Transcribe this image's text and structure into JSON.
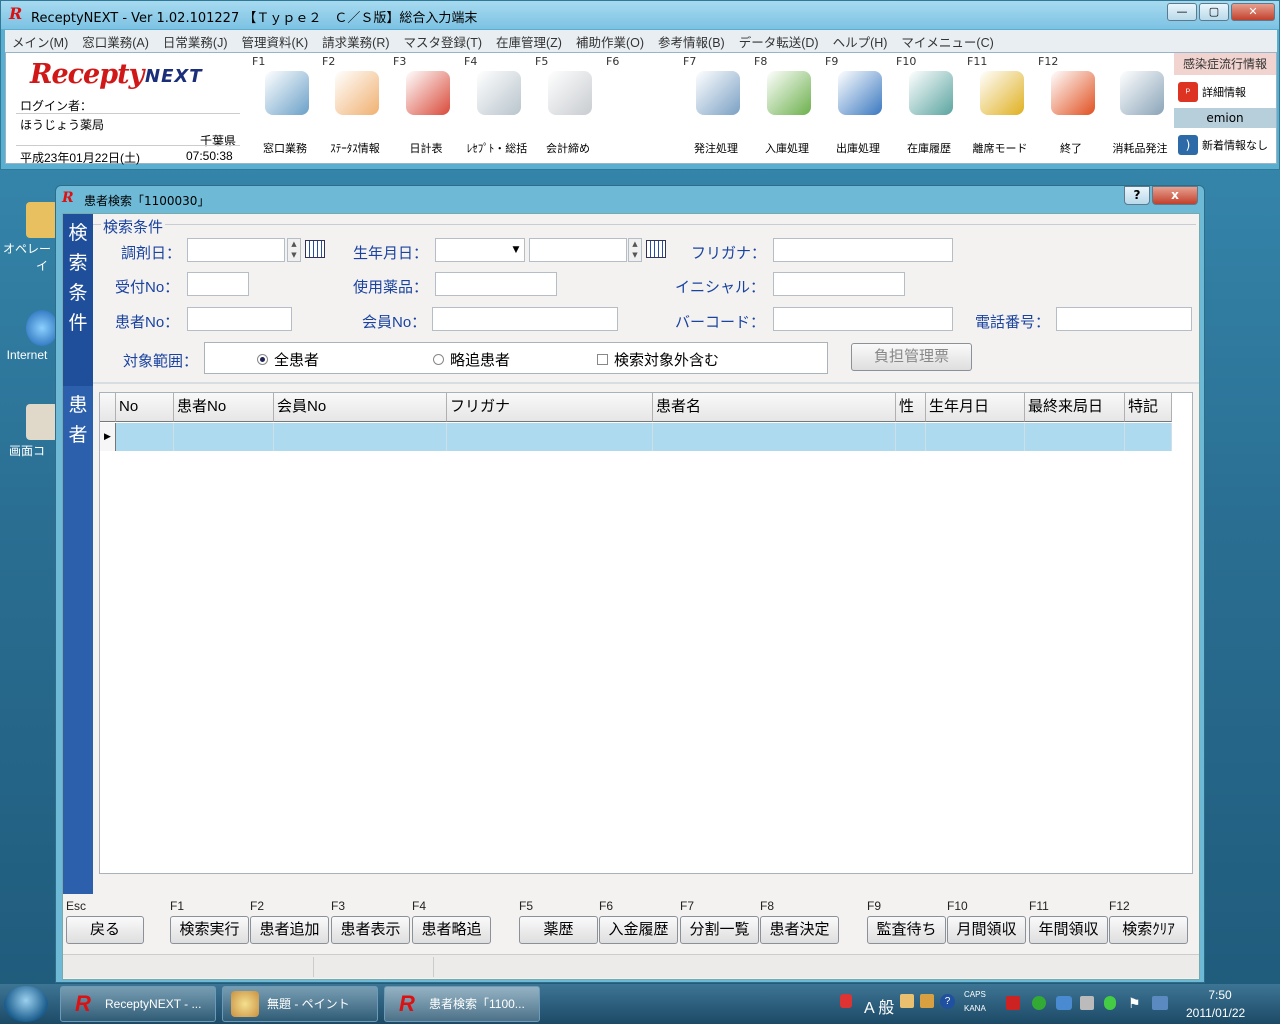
{
  "main_window": {
    "title": "ReceptyNEXT - Ver 1.02.101227 【Ｔｙｐｅ２　Ｃ／Ｓ版】総合入力端末",
    "menus": [
      "メイン(M)",
      "窓口業務(A)",
      "日常業務(J)",
      "管理資料(K)",
      "請求業務(R)",
      "マスタ登録(T)",
      "在庫管理(Z)",
      "補助作業(O)",
      "参考情報(B)",
      "データ転送(D)",
      "ヘルプ(H)",
      "マイメニュー(C)"
    ],
    "logo_brand": "Recepty",
    "logo_next": "NEXT",
    "login_label": "ログイン者：",
    "pharmacy": "ほうじょう薬局",
    "prefecture": "千葉県",
    "date": "平成23年01月22日(土)",
    "time": "07:50:38",
    "toolbar": [
      {
        "key": "F1",
        "label": "窓口業務",
        "icon": "computer-icon",
        "color": "#6aa0c8"
      },
      {
        "key": "F2",
        "label": "ｽﾃｰﾀｽ情報",
        "icon": "people-icon",
        "color": "#f0b070"
      },
      {
        "key": "F3",
        "label": "日計表",
        "icon": "bar-chart-icon",
        "color": "#d84a3a"
      },
      {
        "key": "F4",
        "label": "ﾚｾﾌﾟﾄ・総括",
        "icon": "document-icon",
        "color": "#b8c4cc"
      },
      {
        "key": "F5",
        "label": "会計締め",
        "icon": "cash-register-icon",
        "color": "#c8ccd0"
      },
      {
        "key": "F6",
        "label": "",
        "icon": "",
        "color": ""
      },
      {
        "key": "F7",
        "label": "発注処理",
        "icon": "clipboard-icon",
        "color": "#7aa0c4"
      },
      {
        "key": "F8",
        "label": "入庫処理",
        "icon": "box-in-icon",
        "color": "#6cb04c"
      },
      {
        "key": "F9",
        "label": "出庫処理",
        "icon": "box-out-icon",
        "color": "#3a78c0"
      },
      {
        "key": "F10",
        "label": "在庫履歴",
        "icon": "boxes-icon",
        "color": "#5aa4a0"
      },
      {
        "key": "F11",
        "label": "離席モード",
        "icon": "lock-icon",
        "color": "#e0b020"
      },
      {
        "key": "F12",
        "label": "終了",
        "icon": "power-icon",
        "color": "#e05020"
      },
      {
        "key": "",
        "label": "消耗品発注",
        "icon": "cart-icon",
        "color": "#8aa4b8"
      }
    ],
    "info_header": "感染症流行情報",
    "info_detail": "詳細情報",
    "info_emion": "emion",
    "info_news": "新着情報なし"
  },
  "desktop_icons": [
    {
      "label": "オペレー",
      "label2": "イ",
      "icon": "folder-icon"
    },
    {
      "label": "Internet",
      "icon": "ie-icon"
    },
    {
      "label": "画面コ",
      "icon": "shortcut-icon"
    }
  ],
  "dialog": {
    "title": "患者検索「1100030」",
    "help_btn": "?",
    "close_btn": "x",
    "tab_search": "検索条件",
    "tab_patient": "患者",
    "group_label": "検索条件",
    "fields": {
      "dispense_date": "調剤日：",
      "birth_date": "生年月日：",
      "furigana": "フリガナ：",
      "receipt_no": "受付No：",
      "drug": "使用薬品：",
      "initial": "イニシャル：",
      "patient_no": "患者No：",
      "member_no": "会員No：",
      "barcode": "バーコード：",
      "phone": "電話番号："
    },
    "scope_label": "対象範囲：",
    "radio_all": "全患者",
    "radio_abbrev": "略追患者",
    "check_exclude": "検索対象外含む",
    "burden_button": "負担管理票",
    "columns": [
      "No",
      "患者No",
      "会員No",
      "フリガナ",
      "患者名",
      "性",
      "生年月日",
      "最終来局日",
      "特記"
    ],
    "row_marker": "▶",
    "fkeys": [
      {
        "key": "Esc",
        "label": "戻る"
      },
      {
        "key": "F1",
        "label": "検索実行"
      },
      {
        "key": "F2",
        "label": "患者追加"
      },
      {
        "key": "F3",
        "label": "患者表示"
      },
      {
        "key": "F4",
        "label": "患者略追"
      },
      {
        "key": "F5",
        "label": "薬歴"
      },
      {
        "key": "F6",
        "label": "入金履歴"
      },
      {
        "key": "F7",
        "label": "分割一覧"
      },
      {
        "key": "F8",
        "label": "患者決定"
      },
      {
        "key": "F9",
        "label": "監査待ち"
      },
      {
        "key": "F10",
        "label": "月間領収"
      },
      {
        "key": "F11",
        "label": "年間領収"
      },
      {
        "key": "F12",
        "label": "検索ｸﾘｱ"
      }
    ]
  },
  "taskbar": {
    "buttons": [
      "ReceptyNEXT - ...",
      "無題 - ペイント",
      "患者検索「1100..."
    ],
    "ime": "A 般",
    "caps": "CAPS",
    "kana": "KANA",
    "clock_time": "7:50",
    "clock_date": "2011/01/22"
  }
}
